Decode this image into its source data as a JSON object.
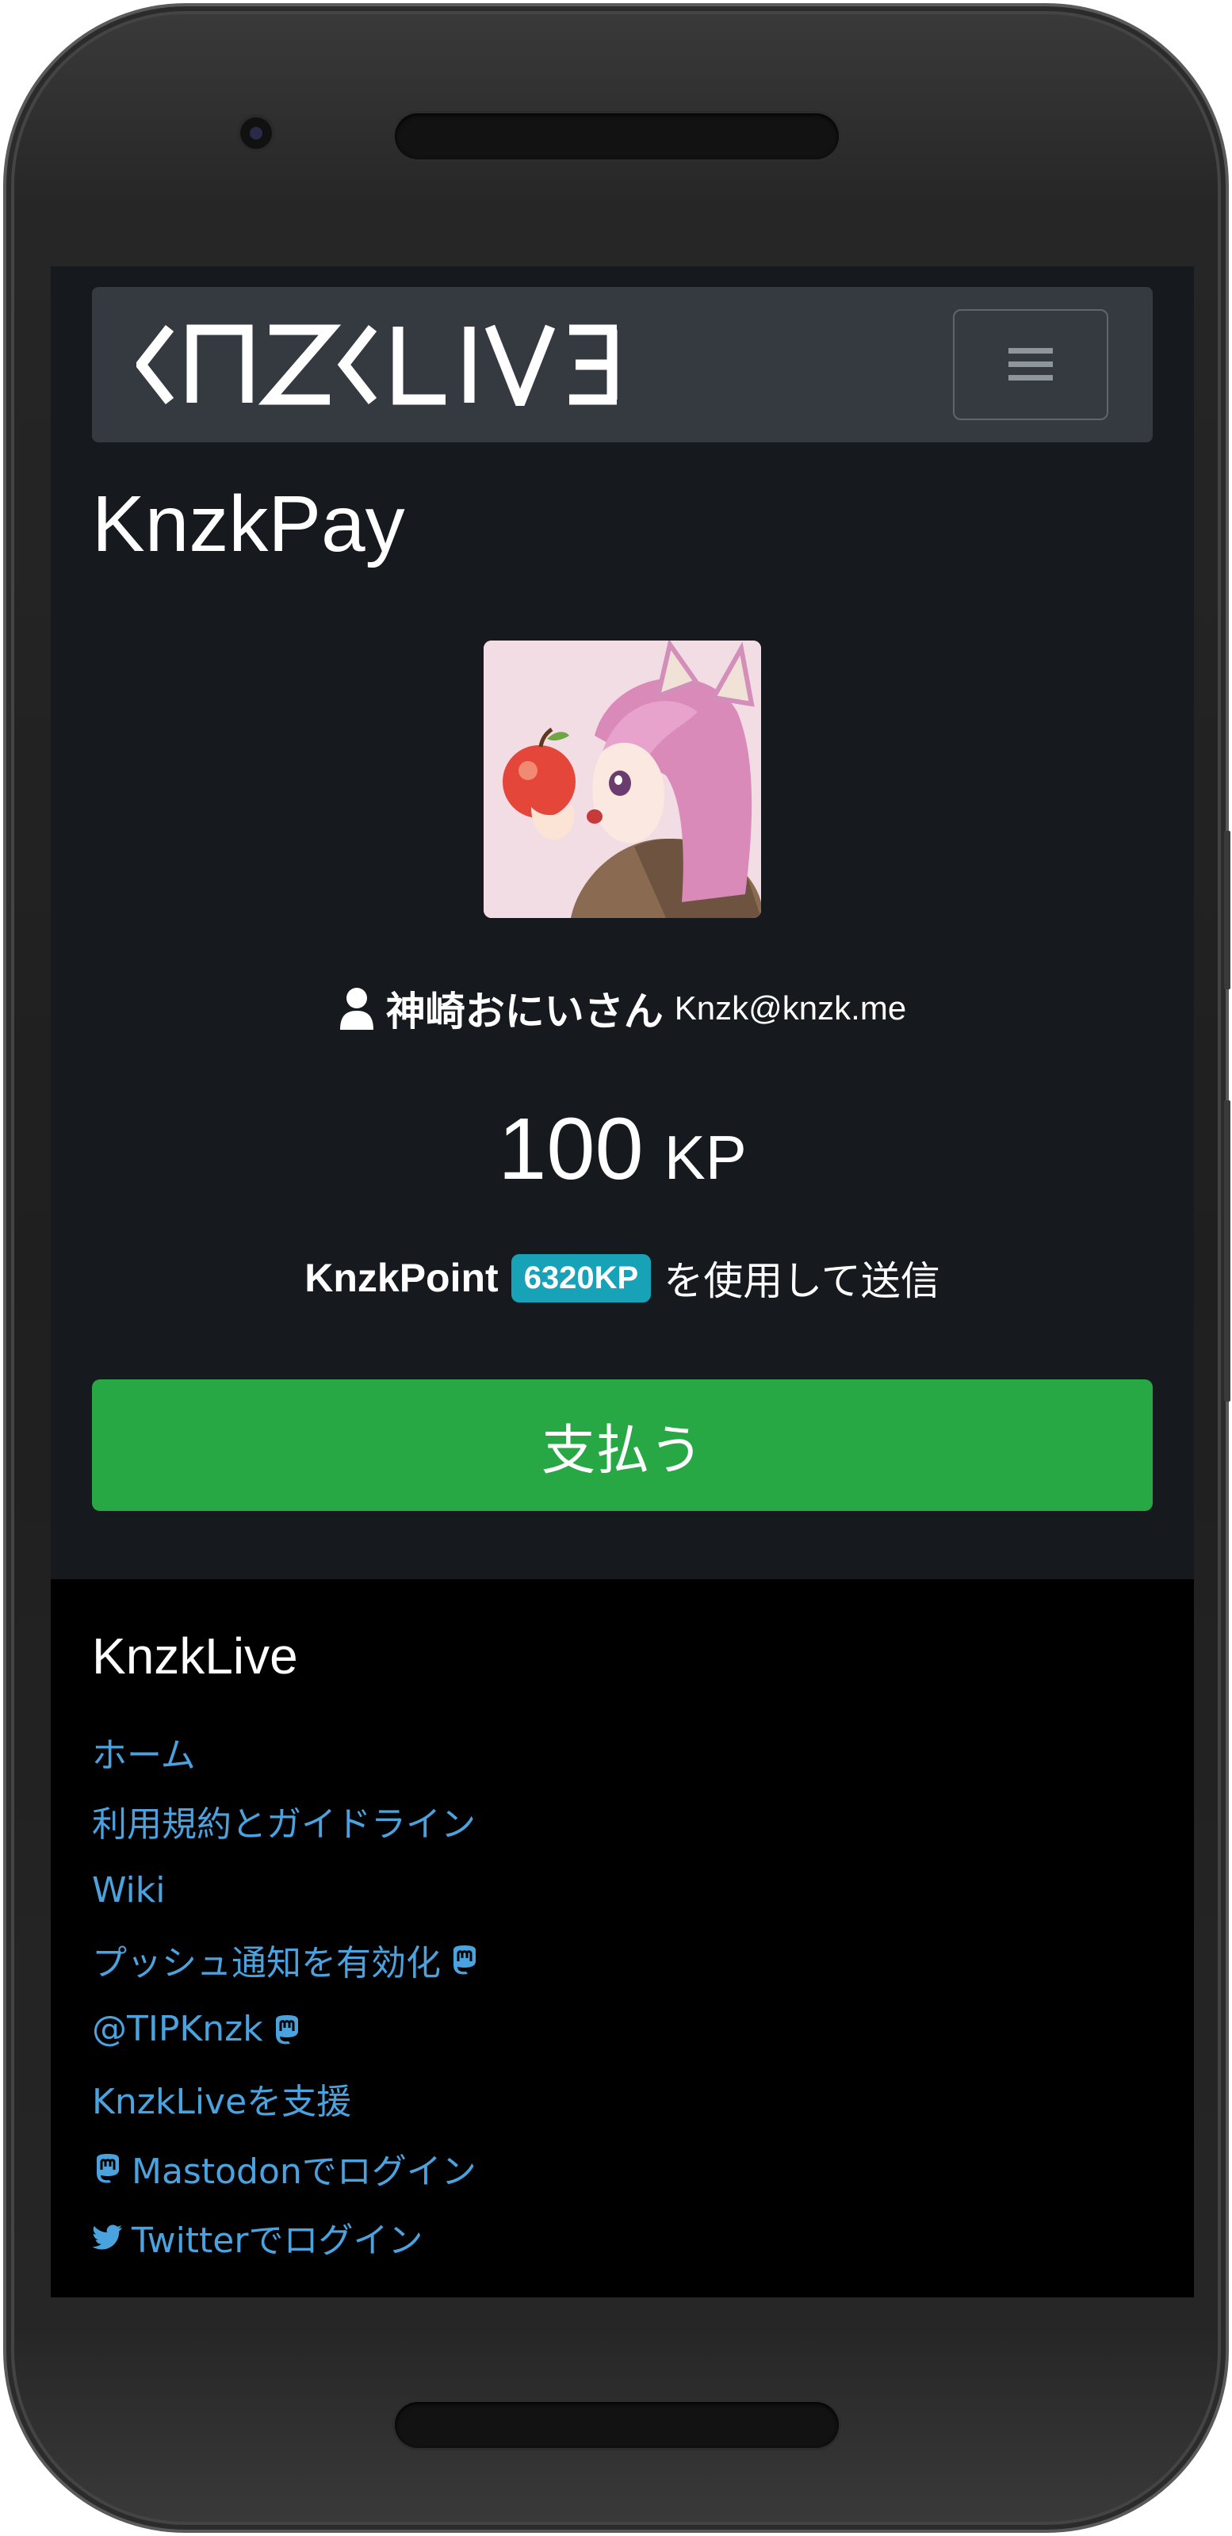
{
  "navbar": {
    "brand": "KNZKLIVE",
    "menu_icon": "hamburger-icon"
  },
  "page": {
    "title": "KnzkPay"
  },
  "recipient": {
    "user_icon": "user-icon",
    "name": "神崎おにいさん",
    "handle": "Knzk@knzk.me"
  },
  "payment": {
    "amount": "100",
    "unit": "KP",
    "points_label": "KnzkPoint",
    "balance_badge": "6320KP",
    "suffix": "を使用して送信",
    "pay_button": "支払う"
  },
  "footer": {
    "title": "KnzkLive",
    "links": [
      {
        "label": "ホーム",
        "icon_before": "",
        "icon_after": ""
      },
      {
        "label": "利用規約とガイドライン",
        "icon_before": "",
        "icon_after": ""
      },
      {
        "label": "Wiki",
        "icon_before": "",
        "icon_after": ""
      },
      {
        "label": "プッシュ通知を有効化",
        "icon_before": "",
        "icon_after": "mastodon-icon"
      },
      {
        "label": "@TIPKnzk",
        "icon_before": "",
        "icon_after": "mastodon-icon"
      },
      {
        "label": "KnzkLiveを支援",
        "icon_before": "",
        "icon_after": ""
      },
      {
        "label": "Mastodonでログイン",
        "icon_before": "mastodon-icon",
        "icon_after": ""
      },
      {
        "label": "Twitterでログイン",
        "icon_before": "twitter-icon",
        "icon_after": ""
      }
    ]
  },
  "colors": {
    "navbar_bg": "#343a40",
    "page_bg": "#16191d",
    "footer_bg": "#000000",
    "link": "#4aa3df",
    "pay_button": "#28a745",
    "badge": "#17a2b8"
  }
}
